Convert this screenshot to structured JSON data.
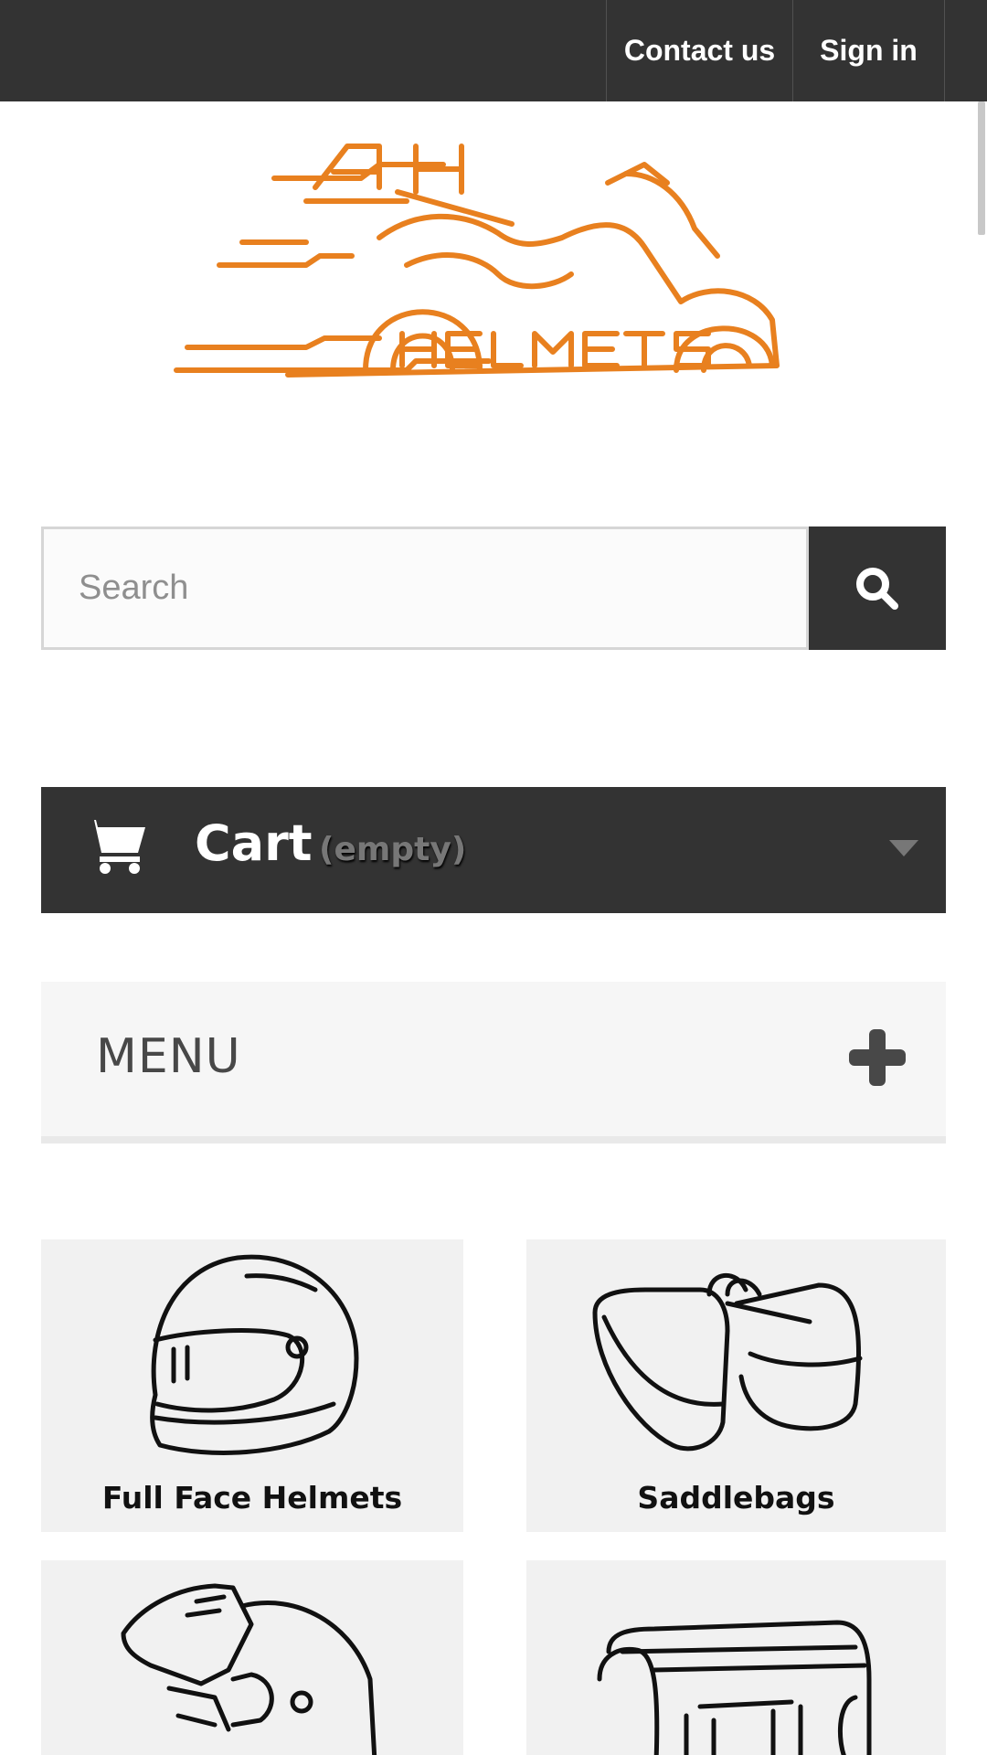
{
  "topbar": {
    "contact_label": "Contact us",
    "signin_label": "Sign in"
  },
  "logo": {
    "text": "AH HELMETS",
    "color": "#e8801f"
  },
  "search": {
    "placeholder": "Search",
    "value": ""
  },
  "cart": {
    "label": "Cart",
    "status": "(empty)"
  },
  "menu": {
    "label": "MENU"
  },
  "categories": [
    {
      "label": "Full Face Helmets",
      "icon": "full-face-helmet-icon"
    },
    {
      "label": "Saddlebags",
      "icon": "saddlebags-icon"
    },
    {
      "label": "",
      "icon": "modular-helmet-icon"
    },
    {
      "label": "",
      "icon": "duffel-bag-icon"
    }
  ],
  "colors": {
    "dark": "#333333",
    "accent": "#e8801f",
    "tile_bg": "#f1f1f1"
  }
}
